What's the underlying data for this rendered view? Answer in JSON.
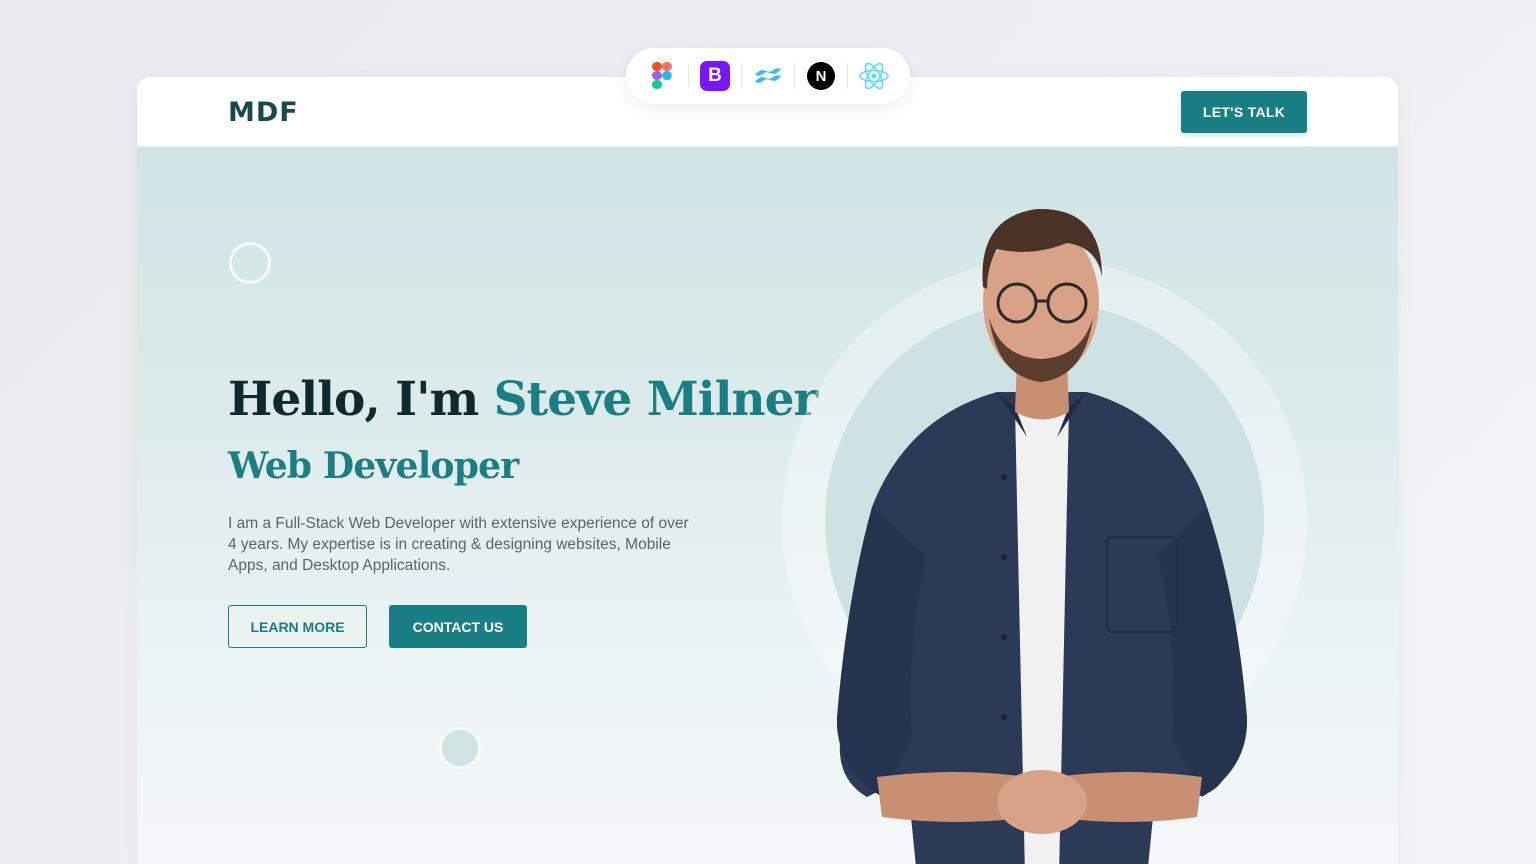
{
  "tech_toolbar": {
    "icons": [
      "figma-icon",
      "bootstrap-icon",
      "tailwind-icon",
      "nextjs-icon",
      "react-icon"
    ],
    "bootstrap_letter": "B",
    "next_letter": "N"
  },
  "header": {
    "logo": "MDF",
    "cta_label": "LET'S TALK"
  },
  "hero": {
    "greeting": "Hello, I'm ",
    "name": "Steve Milner",
    "role": "Web Developer",
    "description": "I am a Full-Stack Web Developer with extensive experience of over 4 years. My expertise is in creating & designing websites, Mobile Apps, and Desktop Applications.",
    "learn_more_label": "LEARN MORE",
    "contact_label": "CONTACT US"
  },
  "colors": {
    "accent": "#1a7f84",
    "dark_text": "#0f2a2b",
    "hero_bg_top": "#d0e4e5",
    "shirt": "#2b3b57"
  }
}
